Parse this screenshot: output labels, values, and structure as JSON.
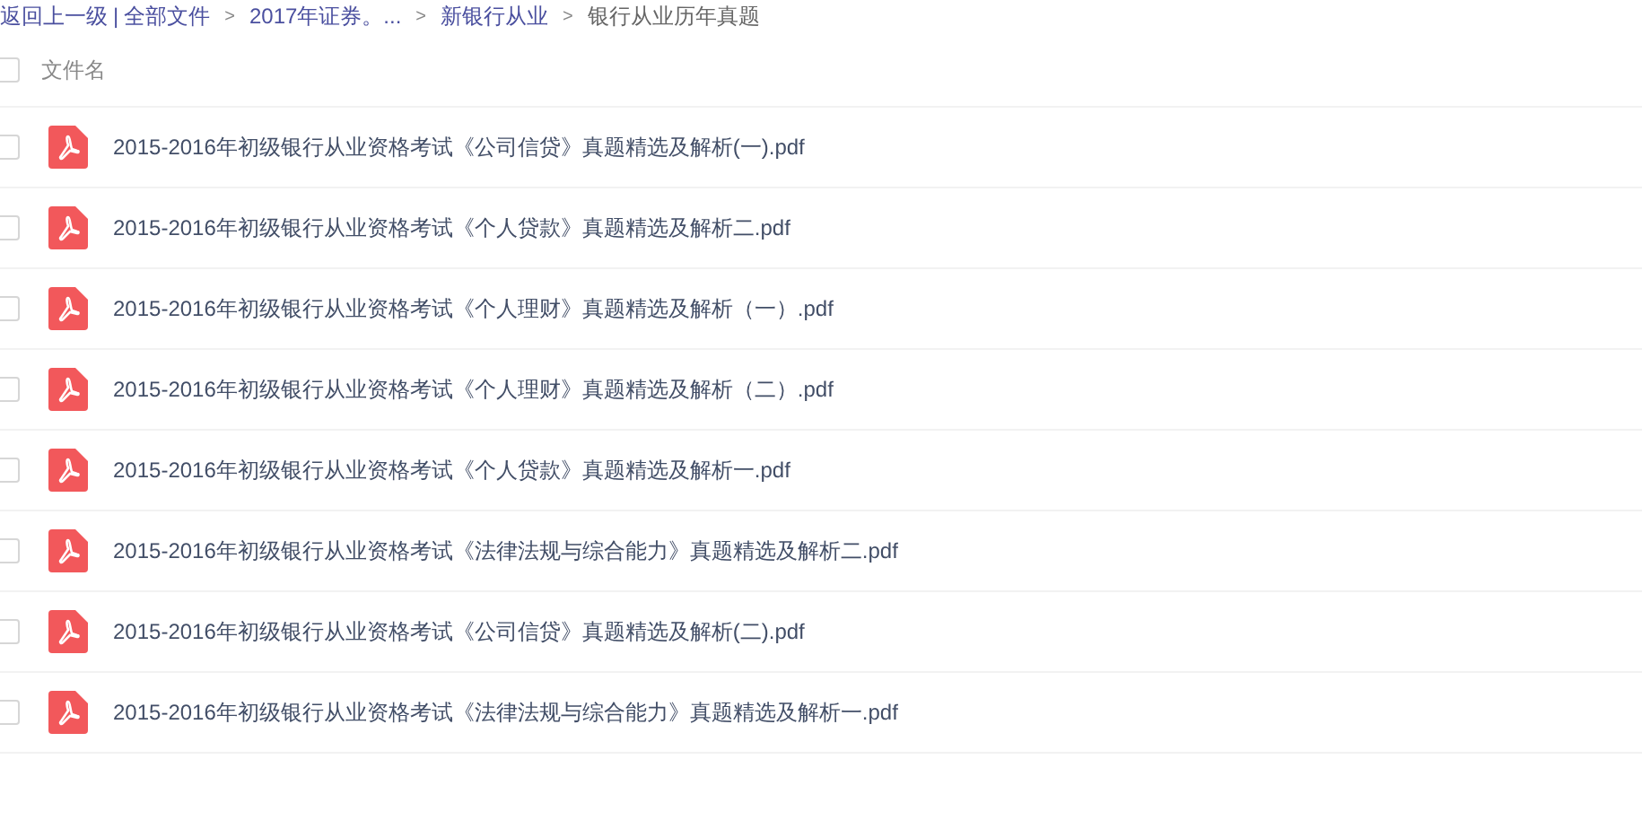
{
  "breadcrumb": [
    {
      "kind": "link",
      "label": "返回上一级"
    },
    {
      "kind": "separator",
      "label": "|"
    },
    {
      "kind": "link",
      "label": "全部文件"
    },
    {
      "kind": "chevron",
      "label": ">"
    },
    {
      "kind": "link",
      "label": "2017年证券。..."
    },
    {
      "kind": "chevron",
      "label": ">"
    },
    {
      "kind": "link",
      "label": "新银行从业"
    },
    {
      "kind": "chevron",
      "label": ">"
    },
    {
      "kind": "current",
      "label": "银行从业历年真题"
    }
  ],
  "header": {
    "checked": false,
    "column": "文件名"
  },
  "files": [
    {
      "name": "2015-2016年初级银行从业资格考试《公司信贷》真题精选及解析(一).pdf",
      "checked": false
    },
    {
      "name": "2015-2016年初级银行从业资格考试《个人贷款》真题精选及解析二.pdf",
      "checked": false
    },
    {
      "name": "2015-2016年初级银行从业资格考试《个人理财》真题精选及解析（一）.pdf",
      "checked": false
    },
    {
      "name": "2015-2016年初级银行从业资格考试《个人理财》真题精选及解析（二）.pdf",
      "checked": false
    },
    {
      "name": "2015-2016年初级银行从业资格考试《个人贷款》真题精选及解析一.pdf",
      "checked": false
    },
    {
      "name": "2015-2016年初级银行从业资格考试《法律法规与综合能力》真题精选及解析二.pdf",
      "checked": false
    },
    {
      "name": "2015-2016年初级银行从业资格考试《公司信贷》真题精选及解析(二).pdf",
      "checked": false
    },
    {
      "name": "2015-2016年初级银行从业资格考试《法律法规与综合能力》真题精选及解析一.pdf",
      "checked": false
    }
  ]
}
